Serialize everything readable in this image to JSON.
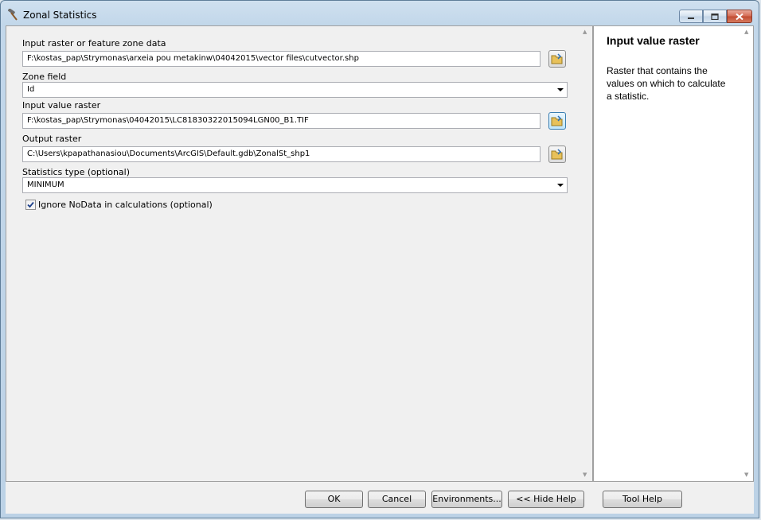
{
  "window": {
    "title": "Zonal Statistics",
    "icon": "hammer-icon"
  },
  "caption_buttons": [
    "minimize-icon",
    "maximize-icon",
    "close-icon"
  ],
  "params": {
    "zone_data": {
      "label": "Input raster or feature zone data",
      "value": "F:\\kostas_pap\\Strymonas\\arxeia pou metakinw\\04042015\\vector files\\cutvector.shp"
    },
    "zone_field": {
      "label": "Zone field",
      "value": "Id"
    },
    "value_raster": {
      "label": "Input value raster",
      "value": "F:\\kostas_pap\\Strymonas\\04042015\\LC81830322015094LGN00_B1.TIF"
    },
    "output_raster": {
      "label": "Output raster",
      "value": "C:\\Users\\kpapathanasiou\\Documents\\ArcGIS\\Default.gdb\\ZonalSt_shp1"
    },
    "statistics_type": {
      "label": "Statistics type (optional)",
      "value": "MINIMUM"
    },
    "ignore_nodata": {
      "label": "Ignore NoData in calculations (optional)",
      "checked": true
    }
  },
  "help": {
    "title": "Input value raster",
    "body": "Raster that contains the values on which to calculate a statistic."
  },
  "buttons": {
    "ok": "OK",
    "cancel": "Cancel",
    "environments": "Environments...",
    "hide_help": "<< Hide Help",
    "tool_help": "Tool Help"
  }
}
